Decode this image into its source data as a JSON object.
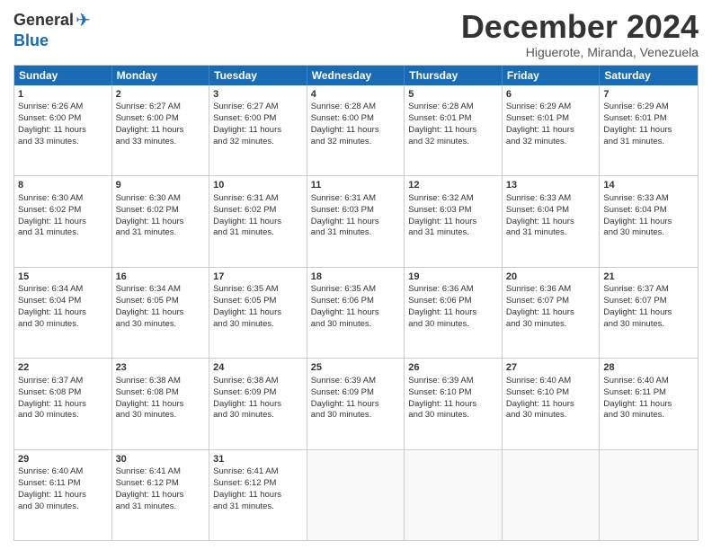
{
  "header": {
    "logo_general": "General",
    "logo_blue": "Blue",
    "month_title": "December 2024",
    "location": "Higuerote, Miranda, Venezuela"
  },
  "weekdays": [
    "Sunday",
    "Monday",
    "Tuesday",
    "Wednesday",
    "Thursday",
    "Friday",
    "Saturday"
  ],
  "weeks": [
    [
      {
        "day": "1",
        "lines": [
          "Sunrise: 6:26 AM",
          "Sunset: 6:00 PM",
          "Daylight: 11 hours",
          "and 33 minutes."
        ]
      },
      {
        "day": "2",
        "lines": [
          "Sunrise: 6:27 AM",
          "Sunset: 6:00 PM",
          "Daylight: 11 hours",
          "and 33 minutes."
        ]
      },
      {
        "day": "3",
        "lines": [
          "Sunrise: 6:27 AM",
          "Sunset: 6:00 PM",
          "Daylight: 11 hours",
          "and 32 minutes."
        ]
      },
      {
        "day": "4",
        "lines": [
          "Sunrise: 6:28 AM",
          "Sunset: 6:00 PM",
          "Daylight: 11 hours",
          "and 32 minutes."
        ]
      },
      {
        "day": "5",
        "lines": [
          "Sunrise: 6:28 AM",
          "Sunset: 6:01 PM",
          "Daylight: 11 hours",
          "and 32 minutes."
        ]
      },
      {
        "day": "6",
        "lines": [
          "Sunrise: 6:29 AM",
          "Sunset: 6:01 PM",
          "Daylight: 11 hours",
          "and 32 minutes."
        ]
      },
      {
        "day": "7",
        "lines": [
          "Sunrise: 6:29 AM",
          "Sunset: 6:01 PM",
          "Daylight: 11 hours",
          "and 31 minutes."
        ]
      }
    ],
    [
      {
        "day": "8",
        "lines": [
          "Sunrise: 6:30 AM",
          "Sunset: 6:02 PM",
          "Daylight: 11 hours",
          "and 31 minutes."
        ]
      },
      {
        "day": "9",
        "lines": [
          "Sunrise: 6:30 AM",
          "Sunset: 6:02 PM",
          "Daylight: 11 hours",
          "and 31 minutes."
        ]
      },
      {
        "day": "10",
        "lines": [
          "Sunrise: 6:31 AM",
          "Sunset: 6:02 PM",
          "Daylight: 11 hours",
          "and 31 minutes."
        ]
      },
      {
        "day": "11",
        "lines": [
          "Sunrise: 6:31 AM",
          "Sunset: 6:03 PM",
          "Daylight: 11 hours",
          "and 31 minutes."
        ]
      },
      {
        "day": "12",
        "lines": [
          "Sunrise: 6:32 AM",
          "Sunset: 6:03 PM",
          "Daylight: 11 hours",
          "and 31 minutes."
        ]
      },
      {
        "day": "13",
        "lines": [
          "Sunrise: 6:33 AM",
          "Sunset: 6:04 PM",
          "Daylight: 11 hours",
          "and 31 minutes."
        ]
      },
      {
        "day": "14",
        "lines": [
          "Sunrise: 6:33 AM",
          "Sunset: 6:04 PM",
          "Daylight: 11 hours",
          "and 30 minutes."
        ]
      }
    ],
    [
      {
        "day": "15",
        "lines": [
          "Sunrise: 6:34 AM",
          "Sunset: 6:04 PM",
          "Daylight: 11 hours",
          "and 30 minutes."
        ]
      },
      {
        "day": "16",
        "lines": [
          "Sunrise: 6:34 AM",
          "Sunset: 6:05 PM",
          "Daylight: 11 hours",
          "and 30 minutes."
        ]
      },
      {
        "day": "17",
        "lines": [
          "Sunrise: 6:35 AM",
          "Sunset: 6:05 PM",
          "Daylight: 11 hours",
          "and 30 minutes."
        ]
      },
      {
        "day": "18",
        "lines": [
          "Sunrise: 6:35 AM",
          "Sunset: 6:06 PM",
          "Daylight: 11 hours",
          "and 30 minutes."
        ]
      },
      {
        "day": "19",
        "lines": [
          "Sunrise: 6:36 AM",
          "Sunset: 6:06 PM",
          "Daylight: 11 hours",
          "and 30 minutes."
        ]
      },
      {
        "day": "20",
        "lines": [
          "Sunrise: 6:36 AM",
          "Sunset: 6:07 PM",
          "Daylight: 11 hours",
          "and 30 minutes."
        ]
      },
      {
        "day": "21",
        "lines": [
          "Sunrise: 6:37 AM",
          "Sunset: 6:07 PM",
          "Daylight: 11 hours",
          "and 30 minutes."
        ]
      }
    ],
    [
      {
        "day": "22",
        "lines": [
          "Sunrise: 6:37 AM",
          "Sunset: 6:08 PM",
          "Daylight: 11 hours",
          "and 30 minutes."
        ]
      },
      {
        "day": "23",
        "lines": [
          "Sunrise: 6:38 AM",
          "Sunset: 6:08 PM",
          "Daylight: 11 hours",
          "and 30 minutes."
        ]
      },
      {
        "day": "24",
        "lines": [
          "Sunrise: 6:38 AM",
          "Sunset: 6:09 PM",
          "Daylight: 11 hours",
          "and 30 minutes."
        ]
      },
      {
        "day": "25",
        "lines": [
          "Sunrise: 6:39 AM",
          "Sunset: 6:09 PM",
          "Daylight: 11 hours",
          "and 30 minutes."
        ]
      },
      {
        "day": "26",
        "lines": [
          "Sunrise: 6:39 AM",
          "Sunset: 6:10 PM",
          "Daylight: 11 hours",
          "and 30 minutes."
        ]
      },
      {
        "day": "27",
        "lines": [
          "Sunrise: 6:40 AM",
          "Sunset: 6:10 PM",
          "Daylight: 11 hours",
          "and 30 minutes."
        ]
      },
      {
        "day": "28",
        "lines": [
          "Sunrise: 6:40 AM",
          "Sunset: 6:11 PM",
          "Daylight: 11 hours",
          "and 30 minutes."
        ]
      }
    ],
    [
      {
        "day": "29",
        "lines": [
          "Sunrise: 6:40 AM",
          "Sunset: 6:11 PM",
          "Daylight: 11 hours",
          "and 30 minutes."
        ]
      },
      {
        "day": "30",
        "lines": [
          "Sunrise: 6:41 AM",
          "Sunset: 6:12 PM",
          "Daylight: 11 hours",
          "and 31 minutes."
        ]
      },
      {
        "day": "31",
        "lines": [
          "Sunrise: 6:41 AM",
          "Sunset: 6:12 PM",
          "Daylight: 11 hours",
          "and 31 minutes."
        ]
      },
      {
        "day": "",
        "lines": []
      },
      {
        "day": "",
        "lines": []
      },
      {
        "day": "",
        "lines": []
      },
      {
        "day": "",
        "lines": []
      }
    ]
  ]
}
